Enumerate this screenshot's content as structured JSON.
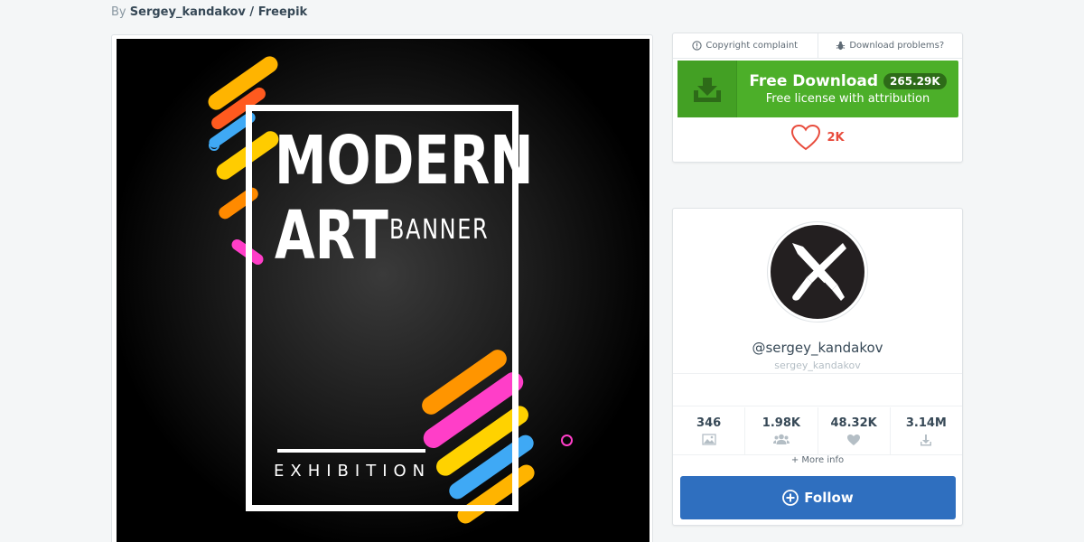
{
  "byline": {
    "prefix": "By",
    "author": "Sergey_kandakov / Freepik"
  },
  "artwork": {
    "line1": "MODERN",
    "line2": "ART",
    "line3": "BANNER",
    "line4": "EXHIBITION"
  },
  "download": {
    "copyright_label": "Copyright complaint",
    "problems_label": "Download problems?",
    "button_title": "Free Download",
    "button_count": "265.29K",
    "button_subtitle": "Free license with attribution",
    "likes": "2K"
  },
  "author": {
    "handle": "@sergey_kandakov",
    "username": "sergey_kandakov",
    "stats": [
      {
        "value": "346",
        "icon": "image-icon"
      },
      {
        "value": "1.98K",
        "icon": "users-icon"
      },
      {
        "value": "48.32K",
        "icon": "heart-icon"
      },
      {
        "value": "3.14M",
        "icon": "download-icon"
      }
    ],
    "more_info": "+ More info",
    "follow_label": "Follow"
  },
  "colors": {
    "download_green": "#4caf29",
    "follow_blue": "#2f6fbf",
    "like_red": "#e84c3d"
  }
}
